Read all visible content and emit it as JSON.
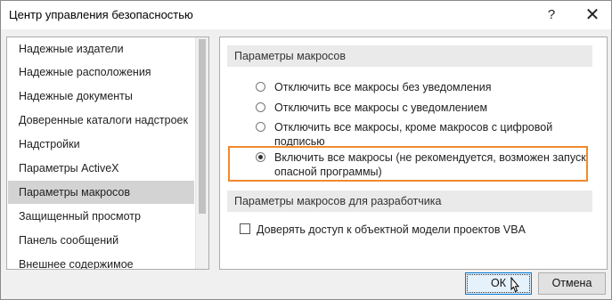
{
  "window": {
    "title": "Центр управления безопасностью",
    "help_label": "?",
    "close_label": "✕"
  },
  "sidebar": {
    "items": [
      {
        "label": "Надежные издатели",
        "selected": false
      },
      {
        "label": "Надежные расположения",
        "selected": false
      },
      {
        "label": "Надежные документы",
        "selected": false
      },
      {
        "label": "Доверенные каталоги надстроек",
        "selected": false
      },
      {
        "label": "Надстройки",
        "selected": false
      },
      {
        "label": "Параметры ActiveX",
        "selected": false
      },
      {
        "label": "Параметры макросов",
        "selected": true
      },
      {
        "label": "Защищенный просмотр",
        "selected": false
      },
      {
        "label": "Панель сообщений",
        "selected": false
      },
      {
        "label": "Внешнее содержимое",
        "selected": false
      }
    ]
  },
  "macro_settings": {
    "header": "Параметры макросов",
    "options": [
      {
        "label": "Отключить все макросы без уведомления",
        "checked": false
      },
      {
        "label": "Отключить все макросы с уведомлением",
        "checked": false
      },
      {
        "label": "Отключить все макросы, кроме макросов с цифровой подписью",
        "checked": false
      },
      {
        "label": "Включить все макросы (не рекомендуется, возможен запуск опасной программы)",
        "checked": true
      }
    ],
    "highlight_color": "#f08a2c"
  },
  "developer_settings": {
    "header": "Параметры макросов для разработчика",
    "trust_vba_label": "Доверять доступ к объектной модели проектов VBA",
    "trust_vba_checked": false
  },
  "buttons": {
    "ok_label": "ОК",
    "cancel_label": "Отмена"
  }
}
